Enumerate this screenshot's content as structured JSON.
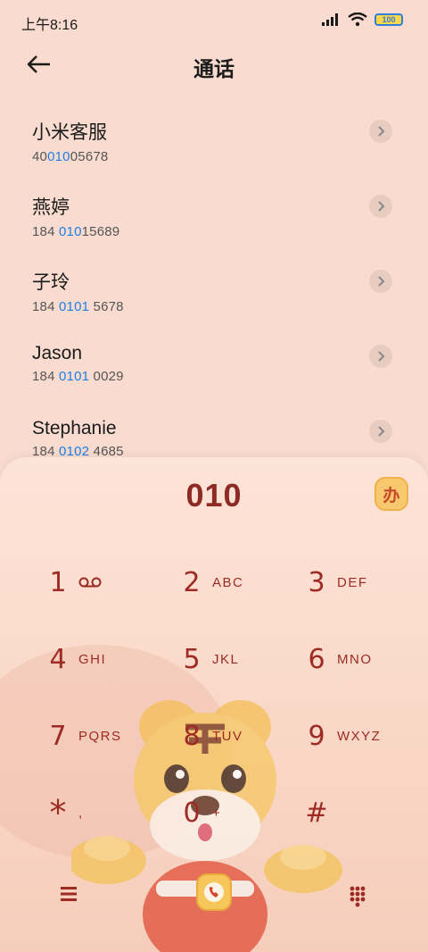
{
  "status_bar": {
    "time": "上午8:16",
    "battery": "100"
  },
  "header": {
    "title": "通话"
  },
  "contacts": [
    {
      "name": "小米客服",
      "number_pre": "40",
      "number_hl": "010",
      "number_post": "05678"
    },
    {
      "name": "燕婷",
      "number_pre": "184 ",
      "number_hl": "010",
      "number_post": "15689"
    },
    {
      "name": "子玲",
      "number_pre": "184 ",
      "number_hl": "0101",
      "number_post": " 5678"
    },
    {
      "name": "Jason",
      "number_pre": "184 ",
      "number_hl": "0101",
      "number_post": " 0029"
    },
    {
      "name": "Stephanie",
      "number_pre": "184 ",
      "number_hl": "0102",
      "number_post": " 4685"
    }
  ],
  "dialer": {
    "input": "010",
    "flash_label": "办",
    "keys": [
      {
        "digit": "1",
        "letters": ""
      },
      {
        "digit": "2",
        "letters": "ABC"
      },
      {
        "digit": "3",
        "letters": "DEF"
      },
      {
        "digit": "4",
        "letters": "GHI"
      },
      {
        "digit": "5",
        "letters": "JKL"
      },
      {
        "digit": "6",
        "letters": "MNO"
      },
      {
        "digit": "7",
        "letters": "PQRS"
      },
      {
        "digit": "8",
        "letters": "TUV"
      },
      {
        "digit": "9",
        "letters": "WXYZ"
      },
      {
        "digit": "*",
        "letters": ","
      },
      {
        "digit": "0",
        "letters": "+"
      },
      {
        "digit": "#",
        "letters": ""
      }
    ]
  },
  "colors": {
    "accent": "#9e2a24",
    "highlight": "#1f7ee6",
    "background": "#f9dccf"
  },
  "icons": {
    "back": "arrow-left-icon",
    "voicemail": "voicemail-icon",
    "menu": "menu-icon",
    "call": "call-icon",
    "dialpad": "dialpad-icon"
  }
}
